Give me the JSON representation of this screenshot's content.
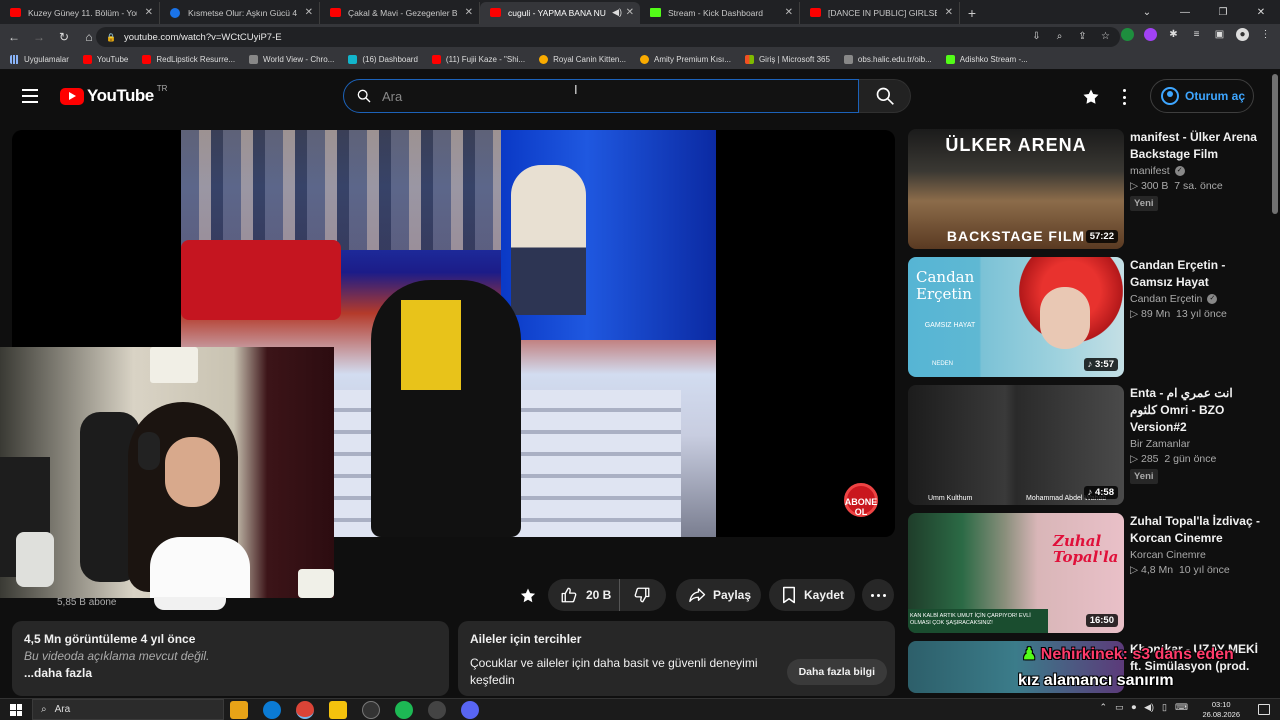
{
  "browser": {
    "tabs": [
      {
        "label": "Kuzey Güney 11. Bölüm - YouTube",
        "favicon": "youtube-icon",
        "active": false
      },
      {
        "label": "Kısmetse Olur: Aşkın Gücü 4.Sez",
        "favicon": "globe-icon",
        "active": false
      },
      {
        "label": "Çakal & Mavi - Gezegenler Birleş",
        "favicon": "youtube-icon",
        "active": false
      },
      {
        "label": "cuguli - YAPMA BANA NUM",
        "favicon": "youtube-icon",
        "active": true
      },
      {
        "label": "Stream - Kick Dashboard",
        "favicon": "kick-icon",
        "active": false
      },
      {
        "label": "[DANCE IN PUBLIC] GIRLSET - Lit",
        "favicon": "youtube-icon",
        "active": false
      }
    ],
    "url": "youtube.com/watch?v=WCtCUyiP7-E",
    "bookmarks": [
      {
        "label": "Uygulamalar",
        "icon": "apps-grid-icon"
      },
      {
        "label": "YouTube",
        "icon": "youtube-icon"
      },
      {
        "label": "RedLipstick Resurre...",
        "icon": "bookmark-icon"
      },
      {
        "label": "World View - Chro...",
        "icon": "image-icon"
      },
      {
        "label": "(16) Dashboard",
        "icon": "dashboard-icon"
      },
      {
        "label": "(11) Fujii Kaze - \"Shi...",
        "icon": "youtube-icon"
      },
      {
        "label": "Royal Canin Kitten...",
        "icon": "bookmark-icon"
      },
      {
        "label": "Amity Premium Kısı...",
        "icon": "bookmark-icon"
      },
      {
        "label": "Giriş | Microsoft 365",
        "icon": "microsoft-icon"
      },
      {
        "label": "obs.halic.edu.tr/oib...",
        "icon": "globe-icon"
      },
      {
        "label": "Adishko Stream -...",
        "icon": "kick-icon"
      }
    ]
  },
  "masthead": {
    "logo_text": "YouTube",
    "region": "TR",
    "search_placeholder": "Ara",
    "signin_label": "Oturum aç"
  },
  "player": {
    "badge_line1": "ABONE",
    "badge_line2": "OL"
  },
  "channel": {
    "subscribers": "5,85 B abone"
  },
  "actions": {
    "likes": "20 B",
    "share_label": "Paylaş",
    "save_label": "Kaydet"
  },
  "description": {
    "stats": "4,5 Mn görüntüleme  4 yıl önce",
    "text": "Bu videoda açıklama mevcut değil.",
    "more": "...daha fazla"
  },
  "family": {
    "title": "Aileler için tercihler",
    "text": "Çocuklar ve aileler için daha basit ve güvenli deneyimi keşfedin",
    "button": "Daha fazla bilgi"
  },
  "recommendations": [
    {
      "title": "manifest - Ülker Arena Backstage Film",
      "channel": "manifest",
      "verified": true,
      "views": "300 B",
      "age": "7 sa. önce",
      "badge": "Yeni",
      "duration": "57:22",
      "thumb_top": "ÜLKER ARENA",
      "thumb_bottom": "BACKSTAGE FILM"
    },
    {
      "title": "Candan Erçetin - Gamsız Hayat",
      "channel": "Candan Erçetin",
      "verified": true,
      "views": "89 Mn",
      "age": "13 yıl önce",
      "badge": "",
      "duration": "3:57",
      "thumb_name": "Candan Erçetin",
      "thumb_sub": "GAMSIZ HAYAT",
      "thumb_foot": "NEDEN"
    },
    {
      "title": "Enta - انت عمري ام كلثوم Omri - BZO Version#2",
      "channel": "Bir Zamanlar",
      "verified": false,
      "views": "285",
      "age": "2 gün önce",
      "badge": "Yeni",
      "duration": "4:58",
      "thumb_cap1": "Umm Kulthum",
      "thumb_cap2": "Mohammad Abdel Wahab"
    },
    {
      "title": "Zuhal Topal'la İzdivaç - Korcan Cinemre",
      "channel": "Korcan Cinemre",
      "verified": false,
      "views": "4,8 Mn",
      "age": "10 yıl önce",
      "badge": "",
      "duration": "16:50",
      "thumb_brand": "Zuhal Topal'la",
      "thumb_caption": "KAN KALBİ ARTIK UMUT İÇİN ÇARPIYOR! EVLİ OLMASI ÇOK ŞAŞIRACAKSINIZ!"
    },
    {
      "title": "Khontkar - UZAY MEKİ ft. Simülasyon (prod.",
      "channel": "",
      "verified": false,
      "views": "",
      "age": "",
      "badge": "",
      "duration": ""
    }
  ],
  "stream_overlay": {
    "line1": "Nehirkinek: s3 dans eden",
    "line2": "kız alamancı sanırım"
  },
  "taskbar": {
    "search_label": "Ara",
    "time": "03:10",
    "date": "26.08.2026"
  },
  "colors": {
    "youtube_red": "#ff0000",
    "link_blue": "#3ea6ff",
    "background": "#0f0f0f",
    "pill": "#272727"
  }
}
